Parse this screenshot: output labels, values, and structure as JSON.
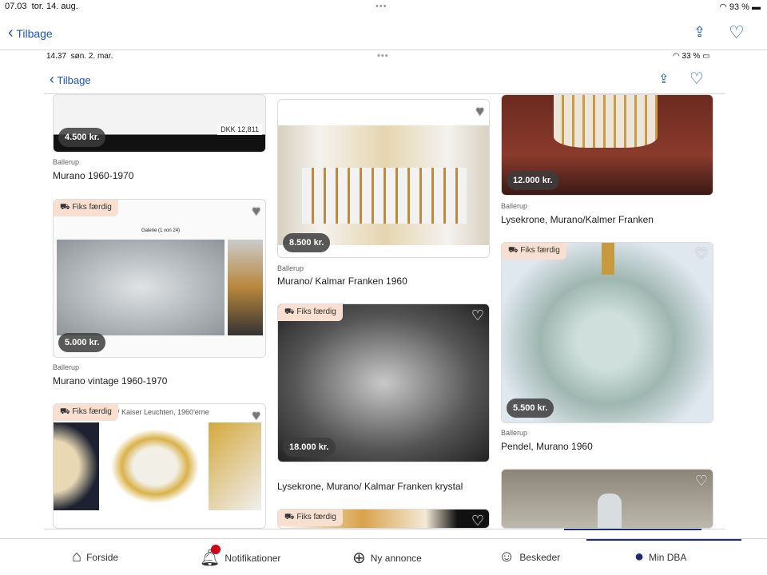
{
  "outer": {
    "time": "07.03",
    "date": "tor. 14. aug.",
    "battery": "93 %",
    "back": "Tilbage"
  },
  "inner": {
    "time": "14.37",
    "date": "søn. 2. mar.",
    "battery": "33 %",
    "back": "Tilbage"
  },
  "badge_label": "Fiks færdig",
  "listings": [
    {
      "price": "4.500 kr.",
      "location": "Ballerup",
      "title": "Murano 1960-1970",
      "inner_text": "DKK 12,811"
    },
    {
      "price": "5.000 kr.",
      "location": "Ballerup",
      "title": "Murano vintage 1960-1970",
      "inner_text": "Galerie (1 von 24)"
    },
    {
      "inner_text": "/ Kaiser Leuchten, 1960'erne"
    },
    {
      "price": "8.500 kr.",
      "location": "Ballerup",
      "title": "Murano/ Kalmar Franken 1960"
    },
    {
      "price": "18.000 kr.",
      "title": "Lysekrone, Murano/ Kalmar Franken krystal"
    },
    {},
    {
      "price": "12.000 kr.",
      "location": "Ballerup",
      "title": "Lysekrone, Murano/Kalmer Franken"
    },
    {
      "price": "5.500 kr.",
      "location": "Ballerup",
      "title": "Pendel, Murano 1960"
    },
    {}
  ],
  "tabs": [
    {
      "label": "Forside",
      "icon": "home-icon"
    },
    {
      "label": "Notifikationer",
      "icon": "bell-icon"
    },
    {
      "label": "Ny annonce",
      "icon": "plus-circle-icon"
    },
    {
      "label": "Beskeder",
      "icon": "message-icon"
    },
    {
      "label": "Min DBA",
      "icon": "profile-icon"
    }
  ],
  "colors": {
    "accent": "#1a56c4",
    "badge": "#f8dfcf",
    "notification": "#d0021b"
  }
}
